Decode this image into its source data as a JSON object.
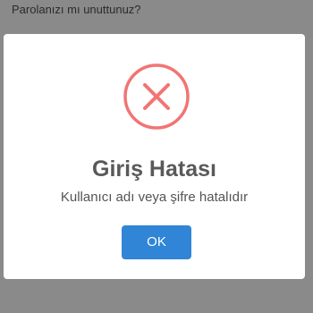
{
  "background": {
    "forgot_password_link": "Parolanızı mı unuttunuz?"
  },
  "dialog": {
    "icon": "error-x-circle-icon",
    "icon_color": "#f27474",
    "title": "Giriş Hatası",
    "message": "Kullanıcı adı veya şifre hatalıdır",
    "confirm_label": "OK",
    "confirm_color": "#3085d6"
  }
}
